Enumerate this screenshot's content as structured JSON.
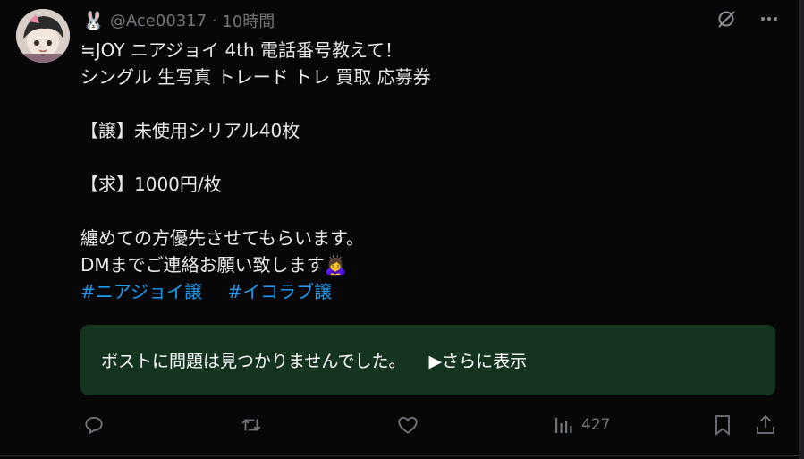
{
  "post": {
    "handle_emoji": "🐰",
    "handle": "@Ace00317",
    "separator": " · ",
    "time": "10時間",
    "lines": [
      "≒JOY ニアジョイ 4th 電話番号教えて！",
      "シングル 生写真 トレード トレ 買取 応募券",
      "",
      "【譲】未使用シリアル40枚",
      "",
      "【求】1000円/枚",
      "",
      "纏めての方優先させてもらいます。",
      "DMまでご連絡お願い致します🙇‍♀️"
    ],
    "hashtags": [
      "#ニアジョイ譲",
      "#イコラブ譲"
    ]
  },
  "notice": {
    "text": "ポストに問題は見つかりませんでした。",
    "more_label": "▶さらに表示"
  },
  "actions": {
    "views": "427"
  },
  "colors": {
    "background": "#070707",
    "accent": "#1d9bf0",
    "notice_bg": "#143420",
    "muted": "#71767b"
  },
  "icons": [
    "avatar",
    "rabbit-emoji",
    "grok-icon",
    "more-icon",
    "reply-icon",
    "repost-icon",
    "like-icon",
    "views-icon",
    "bookmark-icon",
    "share-icon"
  ]
}
